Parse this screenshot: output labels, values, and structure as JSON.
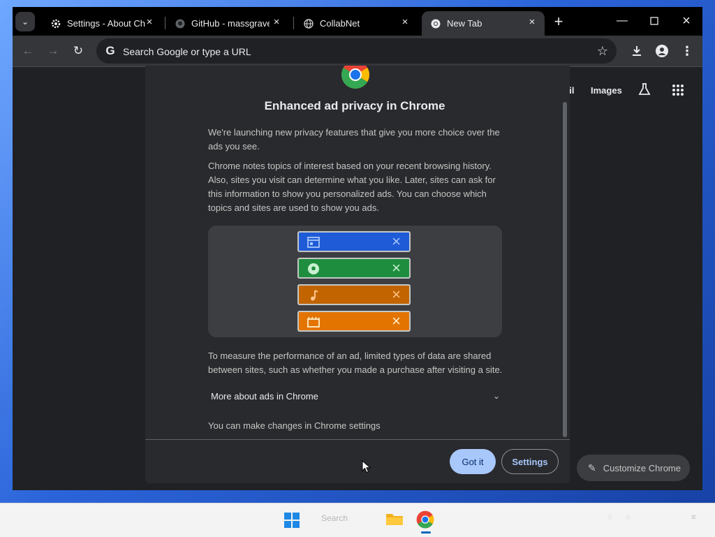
{
  "browser": {
    "tabs": [
      {
        "title": "Settings - About Chrome",
        "icon": "gear-icon",
        "active": false
      },
      {
        "title": "GitHub - massgravel",
        "icon": "github-icon",
        "active": false
      },
      {
        "title": "CollabNet",
        "icon": "globe-icon",
        "active": false
      },
      {
        "title": "New Tab",
        "icon": "chrome-icon",
        "active": true
      }
    ],
    "omnibox": {
      "placeholder": "Search Google or type a URL"
    },
    "window_controls": [
      "minimize",
      "maximize",
      "close"
    ]
  },
  "ntp": {
    "links": [
      "ail",
      "Images"
    ],
    "customize_label": "Customize Chrome"
  },
  "dialog": {
    "title": "Enhanced ad privacy in Chrome",
    "para1": "We're launching new privacy features that give you more choice over the ads you see.",
    "para2": "Chrome notes topics of interest based on your recent browsing history. Also, sites you visit can determine what you like. Later, sites can ask for this information to show you personalized ads. You can choose which topics and sites are used to show you ads.",
    "chips": [
      {
        "icon": "browser-window-icon",
        "color": "#1f5bd6",
        "x_color": "#a8c7fa"
      },
      {
        "icon": "soccer-ball-icon",
        "color": "#1e8e3e",
        "x_color": "#c8f0d0"
      },
      {
        "icon": "music-note-icon",
        "color": "#c26400",
        "x_color": "#ffc48a"
      },
      {
        "icon": "clapperboard-icon",
        "color": "#e37400",
        "x_color": "#fff0cc"
      }
    ],
    "para3": "To measure the performance of an ad, limited types of data are shared between sites, such as whether you made a purchase after visiting a site.",
    "more_label": "More about ads in Chrome",
    "settings_note": "You can make changes in Chrome settings",
    "got_it": "Got it",
    "settings": "Settings"
  },
  "taskbar": {
    "search_label": "Search"
  },
  "colors": {
    "accent": "#a8c7fa",
    "dialog_bg": "#292a2d",
    "toolbar_bg": "#35363a"
  }
}
